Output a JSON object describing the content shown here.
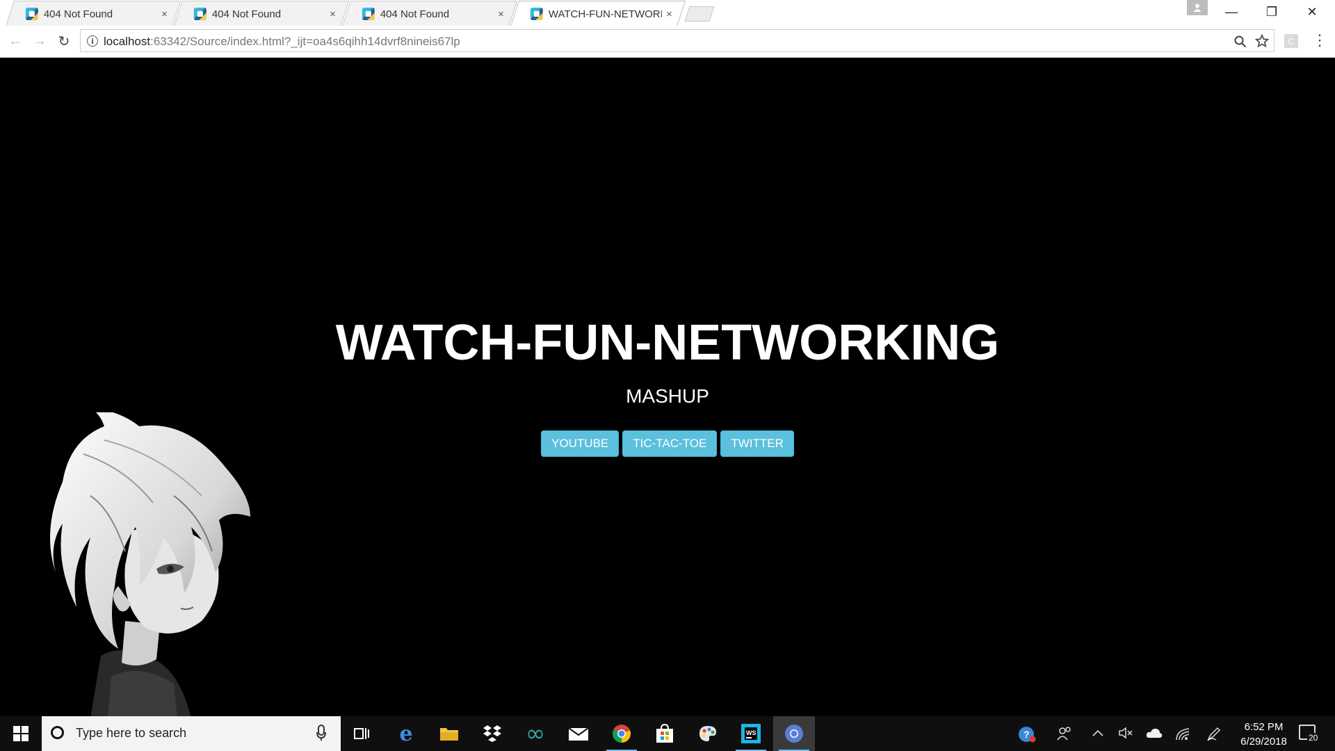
{
  "browser": {
    "tabs": [
      {
        "title": "404 Not Found",
        "close": "×"
      },
      {
        "title": "404 Not Found",
        "close": "×"
      },
      {
        "title": "404 Not Found",
        "close": "×"
      },
      {
        "title": "WATCH-FUN-NETWORKI",
        "close": "×"
      }
    ],
    "window_controls": {
      "minimize": "—",
      "restore": "❐",
      "close": "✕"
    },
    "nav": {
      "back": "←",
      "forward": "→",
      "reload": "↻"
    },
    "address": {
      "host": "localhost",
      "rest": ":63342/Source/index.html?_ijt=oa4s6qihh14dvrf8nineis67lp"
    },
    "extension_letter": "C",
    "menu": "⋮"
  },
  "page": {
    "title": "WATCH-FUN-NETWORKING",
    "subtitle": "MASHUP",
    "buttons": [
      "YOUTUBE",
      "TIC-TAC-TOE",
      "TWITTER"
    ],
    "colors": {
      "background": "#000000",
      "button": "#5bc0de",
      "text": "#ffffff"
    }
  },
  "taskbar": {
    "search_placeholder": "Type here to search",
    "apps": [
      "task-view",
      "edge",
      "file-explorer",
      "dropbox",
      "arduino",
      "mail",
      "chrome",
      "store",
      "paint",
      "webstorm",
      "chrome-active"
    ],
    "clock": {
      "time": "6:52 PM",
      "date": "6/29/2018"
    },
    "notification_count": "20"
  }
}
